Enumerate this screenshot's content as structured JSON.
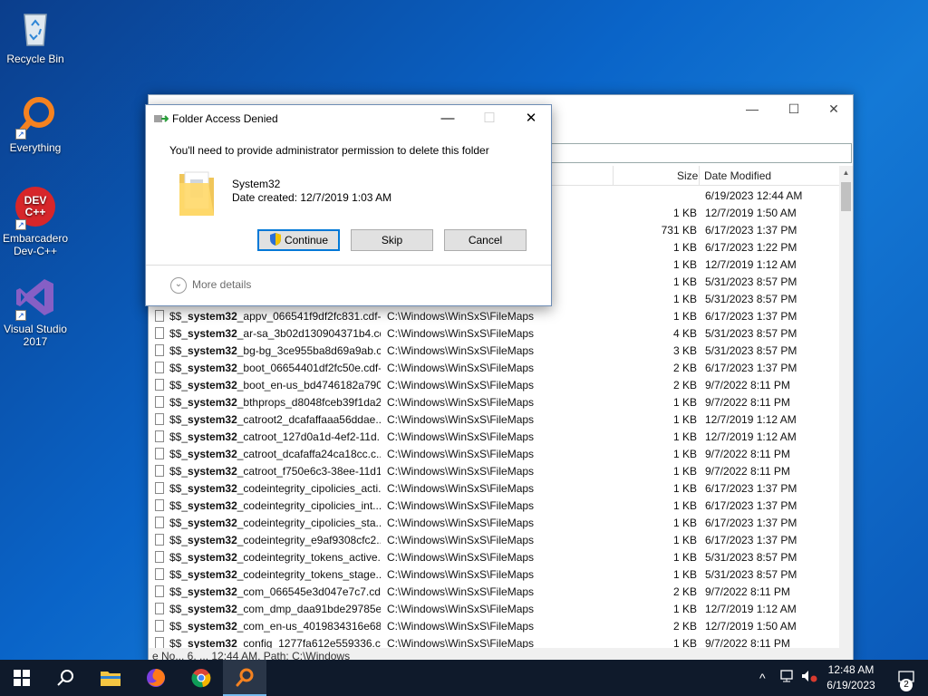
{
  "desktop": {
    "icons": [
      {
        "label": "Recycle Bin"
      },
      {
        "label": "Everything"
      },
      {
        "label": "Embarcadero Dev-C++"
      },
      {
        "label": "Visual Studio 2017"
      }
    ]
  },
  "everything": {
    "columns": {
      "size": "Size",
      "date": "Date Modified"
    },
    "rows": [
      {
        "name": "",
        "bold": "",
        "rest": "",
        "path": "",
        "size": "",
        "date": "6/19/2023 12:44 AM"
      },
      {
        "name": "",
        "bold": "",
        "rest": "",
        "path": "",
        "size": "1 KB",
        "date": "12/7/2019 1:50 AM"
      },
      {
        "name": "",
        "bold": "",
        "rest": "",
        "path": "",
        "size": "731 KB",
        "date": "6/17/2023 1:37 PM"
      },
      {
        "name": "",
        "bold": "",
        "rest": "",
        "path": "",
        "size": "1 KB",
        "date": "6/17/2023 1:22 PM"
      },
      {
        "name": "",
        "bold": "",
        "rest": "",
        "path": "",
        "size": "1 KB",
        "date": "12/7/2019 1:12 AM"
      },
      {
        "name": "",
        "bold": "",
        "rest": "",
        "path": "",
        "size": "1 KB",
        "date": "5/31/2023 8:57 PM"
      },
      {
        "name": "",
        "bold": "",
        "rest": "",
        "path": "",
        "size": "1 KB",
        "date": "5/31/2023 8:57 PM"
      },
      {
        "pre": "$$_",
        "bold": "system32",
        "rest": "_appv_066541f9df2fc831.cdf-...",
        "path": "C:\\Windows\\WinSxS\\FileMaps",
        "size": "1 KB",
        "date": "6/17/2023 1:37 PM"
      },
      {
        "pre": "$$_",
        "bold": "system32",
        "rest": "_ar-sa_3b02d130904371b4.cd...",
        "path": "C:\\Windows\\WinSxS\\FileMaps",
        "size": "4 KB",
        "date": "5/31/2023 8:57 PM"
      },
      {
        "pre": "$$_",
        "bold": "system32",
        "rest": "_bg-bg_3ce955ba8d69a9ab.c...",
        "path": "C:\\Windows\\WinSxS\\FileMaps",
        "size": "3 KB",
        "date": "5/31/2023 8:57 PM"
      },
      {
        "pre": "$$_",
        "bold": "system32",
        "rest": "_boot_06654401df2fc50e.cdf-...",
        "path": "C:\\Windows\\WinSxS\\FileMaps",
        "size": "2 KB",
        "date": "6/17/2023 1:37 PM"
      },
      {
        "pre": "$$_",
        "bold": "system32",
        "rest": "_boot_en-us_bd4746182a790...",
        "path": "C:\\Windows\\WinSxS\\FileMaps",
        "size": "2 KB",
        "date": "9/7/2022 8:11 PM"
      },
      {
        "pre": "$$_",
        "bold": "system32",
        "rest": "_bthprops_d8048fceb39f1da2...",
        "path": "C:\\Windows\\WinSxS\\FileMaps",
        "size": "1 KB",
        "date": "9/7/2022 8:11 PM"
      },
      {
        "pre": "$$_",
        "bold": "system32",
        "rest": "_catroot2_dcafaffaaa56ddae....",
        "path": "C:\\Windows\\WinSxS\\FileMaps",
        "size": "1 KB",
        "date": "12/7/2019 1:12 AM"
      },
      {
        "pre": "$$_",
        "bold": "system32",
        "rest": "_catroot_127d0a1d-4ef2-11d...",
        "path": "C:\\Windows\\WinSxS\\FileMaps",
        "size": "1 KB",
        "date": "12/7/2019 1:12 AM"
      },
      {
        "pre": "$$_",
        "bold": "system32",
        "rest": "_catroot_dcafaffa24ca18cc.c...",
        "path": "C:\\Windows\\WinSxS\\FileMaps",
        "size": "1 KB",
        "date": "9/7/2022 8:11 PM"
      },
      {
        "pre": "$$_",
        "bold": "system32",
        "rest": "_catroot_f750e6c3-38ee-11d1...",
        "path": "C:\\Windows\\WinSxS\\FileMaps",
        "size": "1 KB",
        "date": "9/7/2022 8:11 PM"
      },
      {
        "pre": "$$_",
        "bold": "system32",
        "rest": "_codeintegrity_cipolicies_acti...",
        "path": "C:\\Windows\\WinSxS\\FileMaps",
        "size": "1 KB",
        "date": "6/17/2023 1:37 PM"
      },
      {
        "pre": "$$_",
        "bold": "system32",
        "rest": "_codeintegrity_cipolicies_int...",
        "path": "C:\\Windows\\WinSxS\\FileMaps",
        "size": "1 KB",
        "date": "6/17/2023 1:37 PM"
      },
      {
        "pre": "$$_",
        "bold": "system32",
        "rest": "_codeintegrity_cipolicies_sta...",
        "path": "C:\\Windows\\WinSxS\\FileMaps",
        "size": "1 KB",
        "date": "6/17/2023 1:37 PM"
      },
      {
        "pre": "$$_",
        "bold": "system32",
        "rest": "_codeintegrity_e9af9308cfc2...",
        "path": "C:\\Windows\\WinSxS\\FileMaps",
        "size": "1 KB",
        "date": "6/17/2023 1:37 PM"
      },
      {
        "pre": "$$_",
        "bold": "system32",
        "rest": "_codeintegrity_tokens_active...",
        "path": "C:\\Windows\\WinSxS\\FileMaps",
        "size": "1 KB",
        "date": "5/31/2023 8:57 PM"
      },
      {
        "pre": "$$_",
        "bold": "system32",
        "rest": "_codeintegrity_tokens_stage...",
        "path": "C:\\Windows\\WinSxS\\FileMaps",
        "size": "1 KB",
        "date": "5/31/2023 8:57 PM"
      },
      {
        "pre": "$$_",
        "bold": "system32",
        "rest": "_com_066545e3d047e7c7.cdf...",
        "path": "C:\\Windows\\WinSxS\\FileMaps",
        "size": "2 KB",
        "date": "9/7/2022 8:11 PM"
      },
      {
        "pre": "$$_",
        "bold": "system32",
        "rest": "_com_dmp_daa91bde29785e...",
        "path": "C:\\Windows\\WinSxS\\FileMaps",
        "size": "1 KB",
        "date": "12/7/2019 1:12 AM"
      },
      {
        "pre": "$$_",
        "bold": "system32",
        "rest": "_com_en-us_4019834316e68...",
        "path": "C:\\Windows\\WinSxS\\FileMaps",
        "size": "2 KB",
        "date": "12/7/2019 1:50 AM"
      },
      {
        "pre": "$$_",
        "bold": "system32",
        "rest": "_config_1277fa612e559336.c...",
        "path": "C:\\Windows\\WinSxS\\FileMaps",
        "size": "1 KB",
        "date": "9/7/2022 8:11 PM"
      }
    ],
    "status": "e No... 6, ... 12:44 AM, Path: C:\\Windows"
  },
  "dialog": {
    "title": "Folder Access Denied",
    "message": "You'll need to provide administrator permission to delete this folder",
    "item_name": "System32",
    "item_date": "Date created: 12/7/2019 1:03 AM",
    "buttons": {
      "continue": "Continue",
      "skip": "Skip",
      "cancel": "Cancel"
    },
    "more_details": "More details"
  },
  "taskbar": {
    "time": "12:48 AM",
    "date": "6/19/2023",
    "notification_count": "2"
  },
  "colors": {
    "accent": "#0078d7",
    "taskbar": "#0f1a2b"
  }
}
